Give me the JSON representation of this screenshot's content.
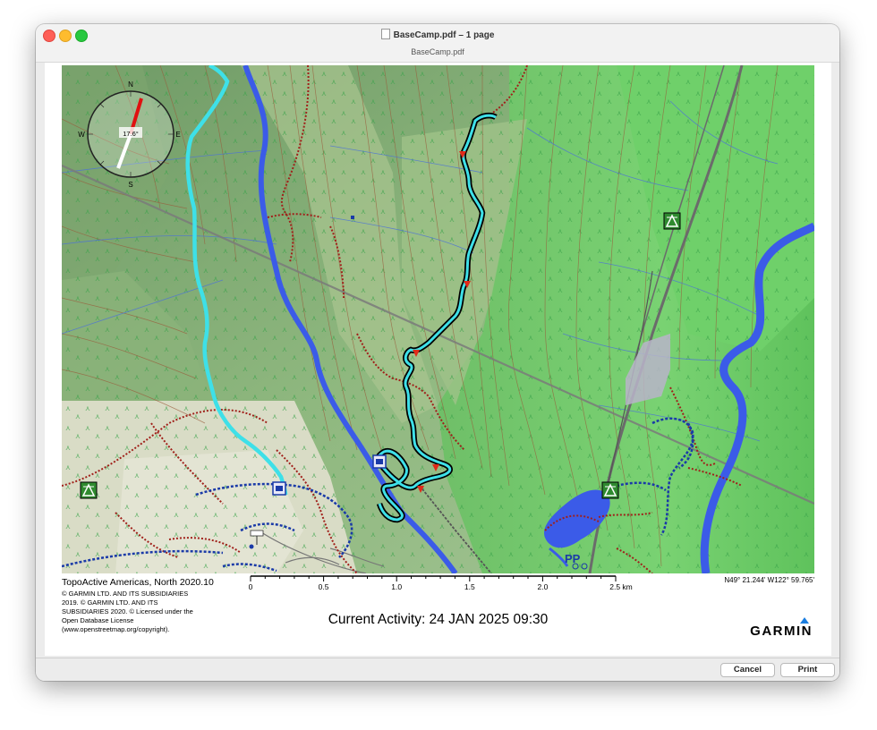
{
  "window": {
    "title": "BaseCamp.pdf – 1 page",
    "subtitle": "BaseCamp.pdf"
  },
  "map": {
    "map_name": "TopoActive Americas, North 2020.10",
    "copyright": "© GARMIN LTD. AND ITS SUBSIDIARIES 2019. © GARMIN LTD. AND ITS SUBSIDIARIES 2020. © Licensed under the Open Database License (www.openstreetmap.org/copyright).",
    "coordinates": "N49° 21.244' W122° 59.765'",
    "activity": "Current Activity: 24 JAN 2025 09:30",
    "brand": "GARMIN",
    "compass": {
      "north": "N",
      "south": "S",
      "east": "E",
      "west": "W",
      "heading": "17.6°"
    },
    "scale": {
      "ticks": [
        "0",
        "0.5",
        "1.0",
        "1.5",
        "2.0",
        "2.5 km"
      ]
    },
    "parking_label": "PP",
    "icons": [
      "compass-icon",
      "campground-icon",
      "parking-icon",
      "trailhead-icon"
    ],
    "colors": {
      "track_active": "#3ee0e8",
      "track_outline": "#000000",
      "river": "#3b5be8",
      "forest_light": "#7fd87a",
      "forest_dark": "#4fb84e",
      "trail_red": "#a0201a",
      "trail_blue": "#1a3aa8"
    }
  },
  "buttons": {
    "cancel": "Cancel",
    "print": "Print"
  }
}
